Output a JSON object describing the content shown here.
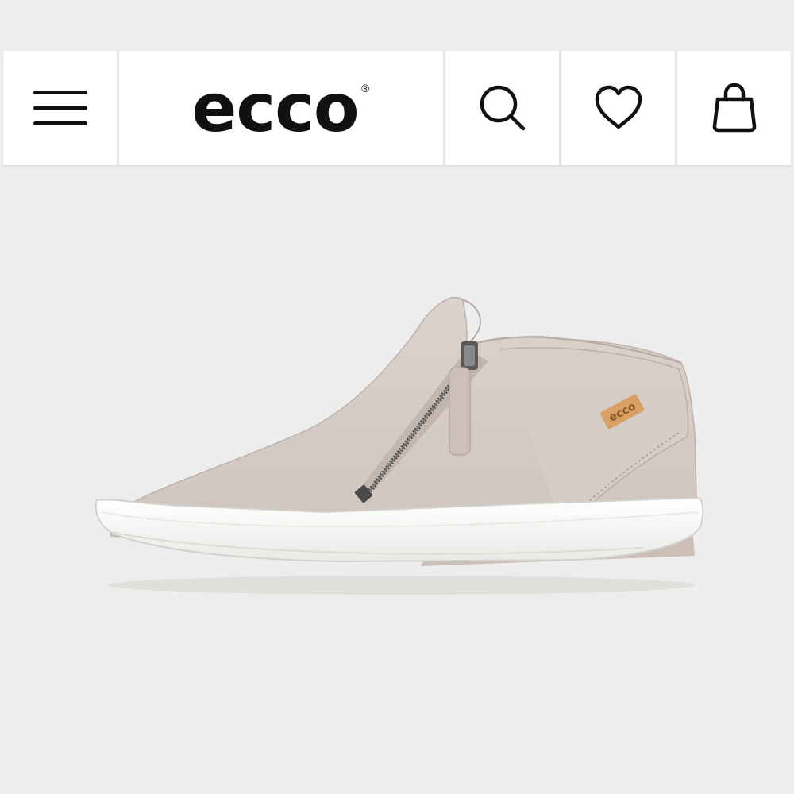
{
  "header": {
    "menu_icon": "hamburger-menu-icon",
    "brand": {
      "logo_text": "ecco",
      "registered_mark": "®"
    },
    "search_icon": "search-icon",
    "wishlist_icon": "heart-icon",
    "bag_icon": "shopping-bag-icon"
  },
  "product": {
    "image": "ankle-sneaker-with-side-zip",
    "badge_text": "ecco"
  },
  "colors": {
    "background": "#ededed",
    "header_bg": "#ffffff",
    "icon": "#111111",
    "shoe_upper": "#d6ccc6",
    "sole": "#ffffff",
    "badge": "#d9a066"
  }
}
